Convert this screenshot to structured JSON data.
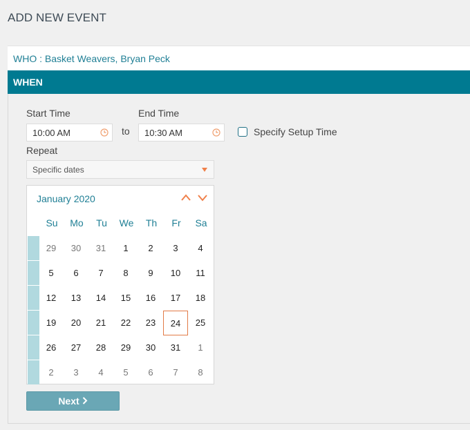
{
  "page": {
    "title": "ADD NEW EVENT"
  },
  "who": {
    "text": "WHO : Basket Weavers, Bryan Peck"
  },
  "when": {
    "label": "WHEN"
  },
  "form": {
    "start_label": "Start Time",
    "start_value": "10:00 AM",
    "end_label": "End Time",
    "end_value": "10:30 AM",
    "to_text": "to",
    "setup_label": "Specify Setup Time",
    "setup_checked": false,
    "repeat_label": "Repeat",
    "repeat_value": "Specific dates",
    "next_label": "Next"
  },
  "calendar": {
    "month_label": "January 2020",
    "weekdays": [
      "Su",
      "Mo",
      "Tu",
      "We",
      "Th",
      "Fr",
      "Sa"
    ],
    "weeks": [
      [
        "29",
        "30",
        "31",
        "1",
        "2",
        "3",
        "4"
      ],
      [
        "5",
        "6",
        "7",
        "8",
        "9",
        "10",
        "11"
      ],
      [
        "12",
        "13",
        "14",
        "15",
        "16",
        "17",
        "18"
      ],
      [
        "19",
        "20",
        "21",
        "22",
        "23",
        "24",
        "25"
      ],
      [
        "26",
        "27",
        "28",
        "29",
        "30",
        "31",
        "1"
      ],
      [
        "2",
        "3",
        "4",
        "5",
        "6",
        "7",
        "8"
      ]
    ],
    "selected_day": "24"
  },
  "colors": {
    "accent": "#007a91",
    "link": "#1f7f95",
    "highlight": "#e27a45",
    "week_marker": "#b1d9df",
    "button": "#6aa7b5"
  },
  "icons": {
    "clock": "clock-icon",
    "prev": "chevron-up-icon",
    "next": "chevron-down-icon",
    "caret": "caret-down-icon",
    "next_chevron": "chevron-right-icon"
  }
}
